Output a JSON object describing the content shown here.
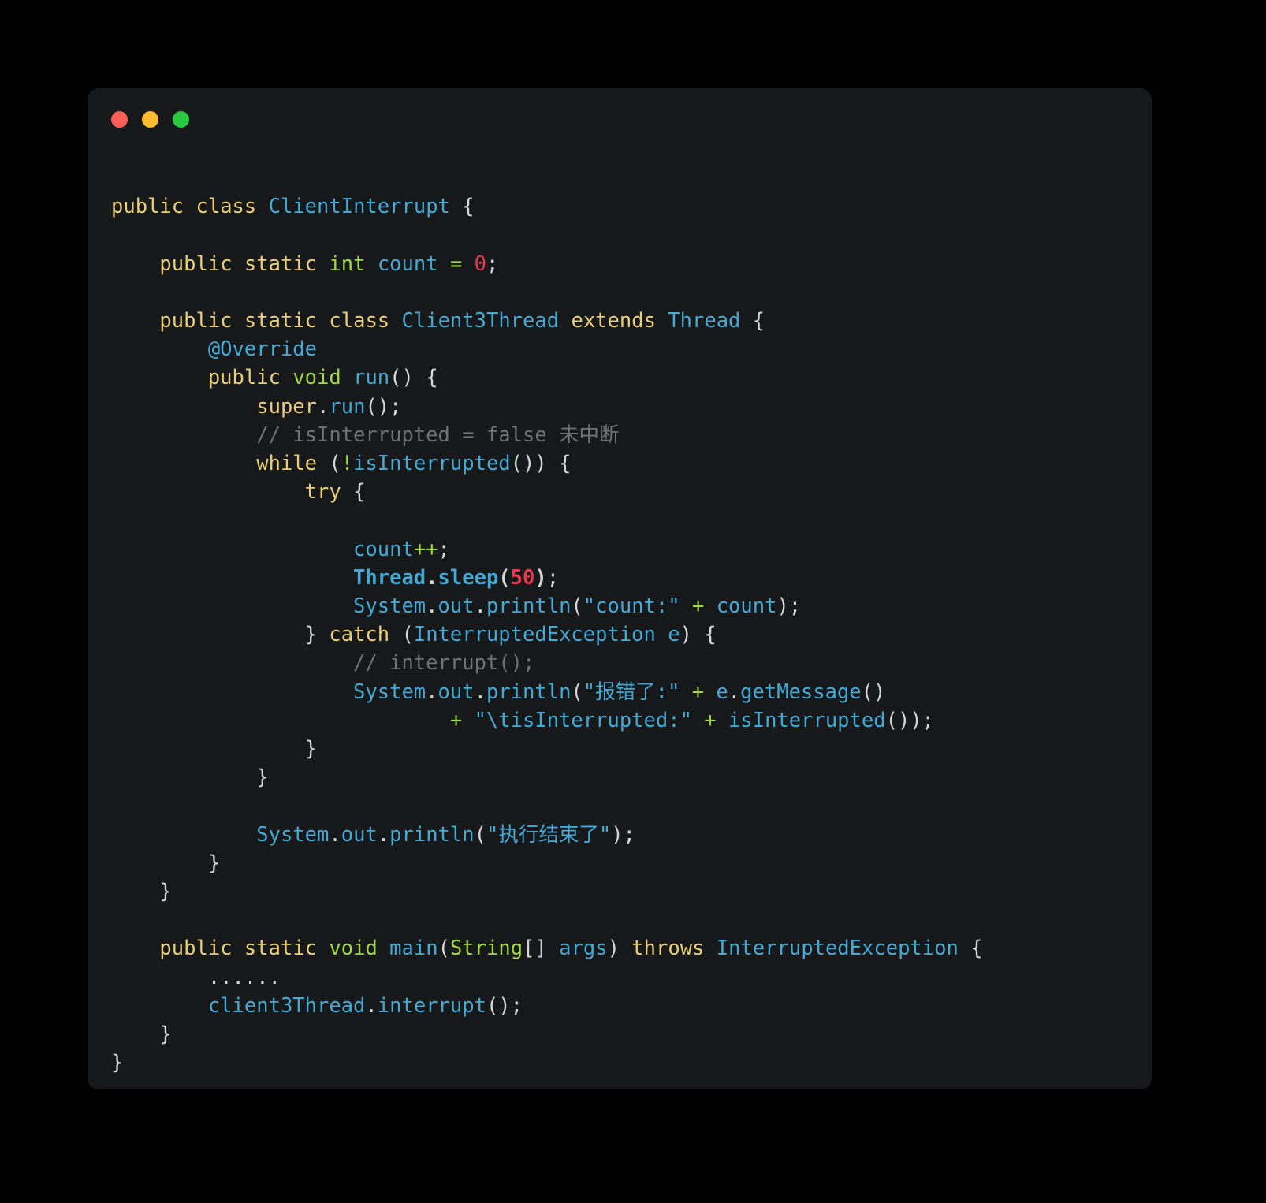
{
  "window": {
    "title_bar": {
      "buttons": [
        {
          "name": "close-button",
          "color": "#ff5f56"
        },
        {
          "name": "minimize-button",
          "color": "#febc2e"
        },
        {
          "name": "maximize-button",
          "color": "#28c840"
        }
      ]
    },
    "background": "#17181a",
    "page_background": "#000000"
  },
  "theme": {
    "keyword": "#e7cf79",
    "type": "#9fd84a",
    "class_name": "#45a9d4",
    "identifier": "#45a9d4",
    "number": "#e8384f",
    "operator": "#9fd84a",
    "string": "#45a9d4",
    "punctuation": "#d6d6d6",
    "comment": "#6f7174"
  },
  "code": {
    "language": "java",
    "plain_text": "public class ClientInterrupt {\n\n    public static int count = 0;\n\n    public static class Client3Thread extends Thread {\n        @Override\n        public void run() {\n            super.run();\n            // isInterrupted = false 未中断\n            while (!isInterrupted()) {\n                try {\n\n                    count++;\n                    Thread.sleep(50);\n                    System.out.println(\"count:\" + count);\n                } catch (InterruptedException e) {\n                    // interrupt();\n                    System.out.println(\"报错了:\" + e.getMessage()\n                            + \"\\tisInterrupted:\" + isInterrupted());\n                }\n            }\n\n            System.out.println(\"执行结束了\");\n        }\n    }\n\n    public static void main(String[] args) throws InterruptedException {\n        ......\n        client3Thread.interrupt();\n    }\n}",
    "lines": [
      "public class ClientInterrupt {",
      "",
      "    public static int count = 0;",
      "",
      "    public static class Client3Thread extends Thread {",
      "        @Override",
      "        public void run() {",
      "            super.run();",
      "            // isInterrupted = false 未中断",
      "            while (!isInterrupted()) {",
      "                try {",
      "",
      "                    count++;",
      "                    Thread.sleep(50);",
      "                    System.out.println(\"count:\" + count);",
      "                } catch (InterruptedException e) {",
      "                    // interrupt();",
      "                    System.out.println(\"报错了:\" + e.getMessage()",
      "                            + \"\\tisInterrupted:\" + isInterrupted());",
      "                }",
      "            }",
      "",
      "            System.out.println(\"执行结束了\");",
      "        }",
      "    }",
      "",
      "    public static void main(String[] args) throws InterruptedException {",
      "        ......",
      "        client3Thread.interrupt();",
      "    }",
      "}"
    ],
    "tokens": {
      "class_name": "ClientInterrupt",
      "inner_class_name": "Client3Thread",
      "super_class": "Thread",
      "field": "count",
      "field_init": "0",
      "annotation": "@Override",
      "method_run": "run",
      "sleep_value": "50",
      "exception_type": "InterruptedException",
      "exception_var": "e",
      "main_args": "args",
      "string_count_label": "\"count:\"",
      "string_error_label": "\"报错了:\"",
      "string_tab_label": "\"\\tisInterrupted:\"",
      "string_finished": "\"执行结束了\"",
      "comment_1": "// isInterrupted = false 未中断",
      "comment_2": "// interrupt();",
      "ellipsis": "......",
      "thread_var": "client3Thread"
    }
  }
}
